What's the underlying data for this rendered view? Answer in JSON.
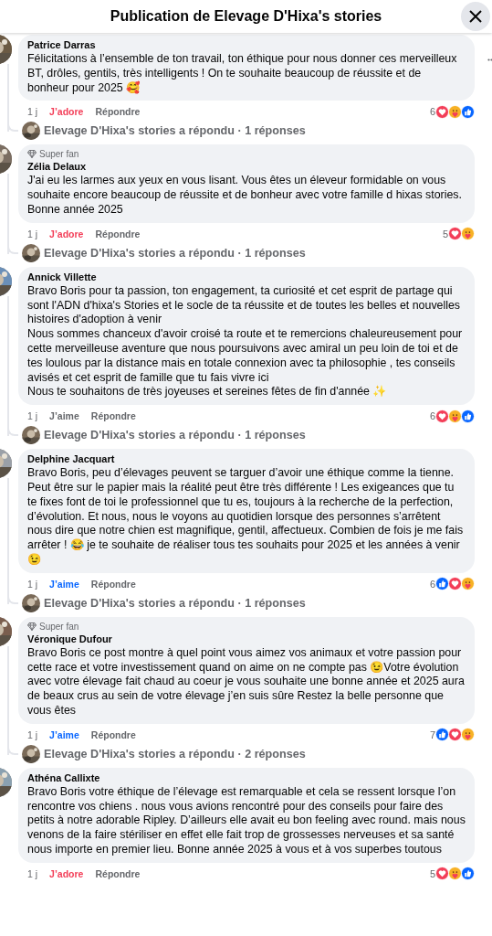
{
  "header": {
    "title": "Publication de Elevage D'Hixa's stories"
  },
  "comments": [
    {
      "author": "Patrice Darras",
      "text": "Félicitations à l’ensemble de ton travail, ton éthique pour nous donner ces merveilleux BT, drôles, gentils, très intelligents ! On te souhaite beaucoup de réussite et de bonheur pour 2025 🥰",
      "time": "1 j",
      "reaction_label": {
        "text": "J’adore",
        "kind": "love"
      },
      "reply_label": "Répondre",
      "count": "6",
      "reactions": [
        {
          "kind": "love"
        },
        {
          "kind": "care"
        },
        {
          "kind": "like"
        }
      ],
      "more_button": true,
      "replies": "Elevage D'Hixa's stories a répondu · 1 réponses"
    },
    {
      "badge": "Super fan",
      "author": "Zélia Delaux",
      "text": "J'ai eu les larmes aux yeux en vous lisant. Vous êtes un éleveur formidable on vous souhaite encore beaucoup de réussite et de bonheur avec votre famille d hixas stories. Bonne année 2025",
      "time": "1 j",
      "reaction_label": {
        "text": "J’adore",
        "kind": "love"
      },
      "reply_label": "Répondre",
      "count": "5",
      "reactions": [
        {
          "kind": "love"
        },
        {
          "kind": "care"
        }
      ],
      "replies": "Elevage D'Hixa's stories a répondu · 1 réponses"
    },
    {
      "author": "Annick Villette",
      "text": "Bravo Boris pour ta passion, ton engagement, ta curiosité et cet esprit de partage qui sont l'ADN d'hixa's Stories et le socle de ta réussite et de toutes les belles et nouvelles histoires d'adoption à venir\nNous sommes chanceux d'avoir croisé ta route et te remercions chaleureusement pour cette merveilleuse aventure que nous poursuivons avec amiral un peu loin de toi et de tes loulous par la distance mais en totale connexion avec ta philosophie , tes conseils avisés et cet esprit de famille que tu fais vivre ici\nNous te souhaitons de très joyeuses et sereines fêtes de fin d'année ✨",
      "time": "1 j",
      "reaction_label": {
        "text": "J’aime",
        "kind": "none"
      },
      "reply_label": "Répondre",
      "count": "6",
      "reactions": [
        {
          "kind": "love"
        },
        {
          "kind": "care"
        },
        {
          "kind": "like"
        }
      ],
      "replies": "Elevage D'Hixa's stories a répondu · 1 réponses"
    },
    {
      "author": "Delphine Jacquart",
      "text": "Bravo Boris, peu d’élevages peuvent se targuer d’avoir une éthique comme la tienne. Peut être sur le papier mais la réalité peut être très différente ! Les exigeances que tu te fixes font de toi le professionnel que tu es, toujours à la recherche de la perfection, d’évolution. Et nous, nous le voyons au quotidien lorsque des personnes s’arrêtent nous dire que notre chien est magnifique, gentil, affectueux. Combien de fois je me fais arrêter ! 😂 je te souhaite de réaliser tous tes souhaits pour 2025 et les années à venir 😉",
      "time": "1 j",
      "reaction_label": {
        "text": "J’aime",
        "kind": "like"
      },
      "reply_label": "Répondre",
      "count": "6",
      "reactions": [
        {
          "kind": "like"
        },
        {
          "kind": "love"
        },
        {
          "kind": "care"
        }
      ],
      "replies": "Elevage D'Hixa's stories a répondu · 1 réponses"
    },
    {
      "badge": "Super fan",
      "author": "Véronique Dufour",
      "text": "Bravo Boris ce post montre à quel point vous aimez vos animaux et votre passion pour cette race et votre investissement quand on aime on ne compte pas 😉Votre évolution avec votre élevage fait chaud au coeur je vous souhaite une bonne année et 2025 aura de beaux crus au sein de votre élevage j’en suis sûre Restez la belle personne que vous êtes",
      "time": "1 j",
      "reaction_label": {
        "text": "J’aime",
        "kind": "like"
      },
      "reply_label": "Répondre",
      "count": "7",
      "reactions": [
        {
          "kind": "like"
        },
        {
          "kind": "love"
        },
        {
          "kind": "care"
        }
      ],
      "replies": "Elevage D'Hixa's stories a répondu · 2 réponses"
    },
    {
      "author": "Athéna Callixte",
      "text": "Bravo Boris votre éthique de l’élevage est remarquable et cela se ressent lorsque l’on rencontre vos chiens . nous vous avions rencontré pour des conseils pour faire des petits à notre adorable Ripley. D’ailleurs elle avait eu bon feeling avec round. mais nous venons de la faire stériliser en effet elle fait trop de grossesses nerveuses et sa santé nous importe en premier lieu. Bonne année 2025 à vous et à vos superbes toutous",
      "time": "1 j",
      "reaction_label": {
        "text": "J’adore",
        "kind": "love"
      },
      "reply_label": "Répondre",
      "count": "5",
      "reactions": [
        {
          "kind": "love"
        },
        {
          "kind": "care"
        },
        {
          "kind": "like"
        }
      ]
    }
  ]
}
